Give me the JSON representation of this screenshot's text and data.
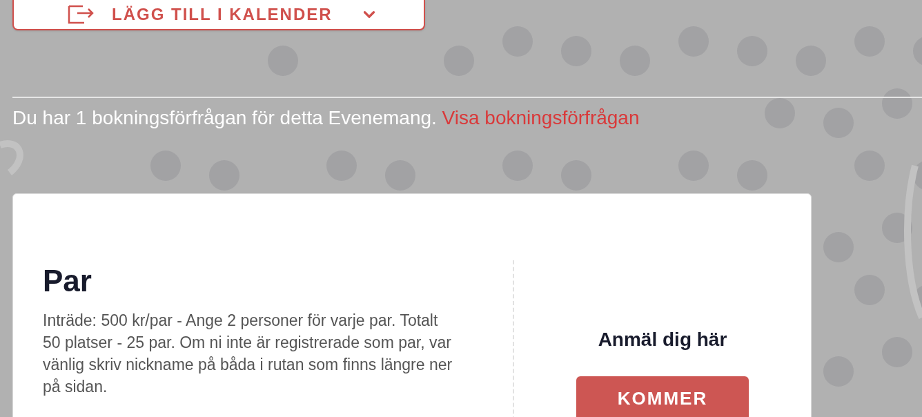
{
  "calendar_button": {
    "label": "LÄGG TILL I KALENDER"
  },
  "notice": {
    "text": "Du har 1 bokningsförfrågan för detta Evenemang.",
    "link": "Visa bokningsförfrågan"
  },
  "ticket": {
    "title": "Par",
    "description": "Inträde: 500 kr/par - Ange 2 personer för varje par. Totalt 50 platser - 25 par. Om ni inte är registrerade som par, var vänlig skriv nickname på båda i rutan som finns längre ner på sidan.",
    "signup_heading": "Anmäl dig här",
    "button": "KOMMER"
  }
}
